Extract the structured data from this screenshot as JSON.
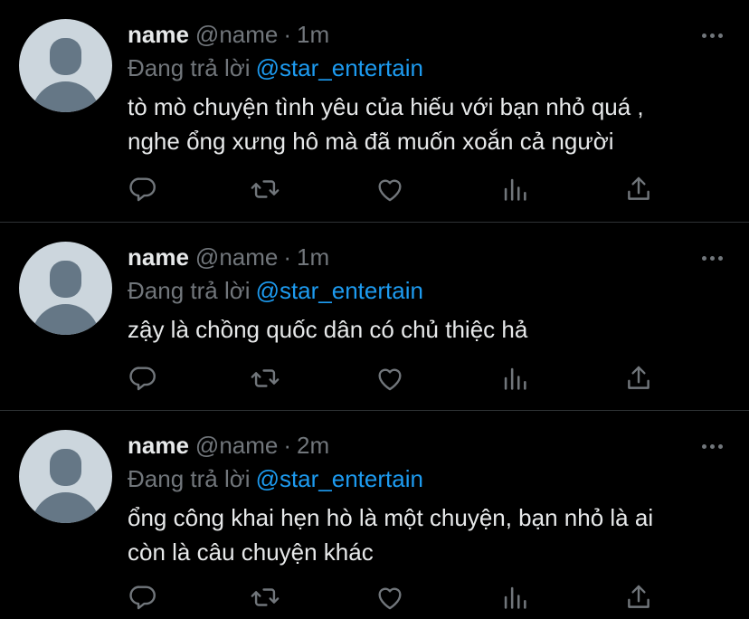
{
  "tweets": [
    {
      "name": "name",
      "handle": "@name",
      "separator": "·",
      "time": "1m",
      "reply_prefix": "Đang trả lời",
      "reply_to": "@star_entertain",
      "text": "tò mò chuyện tình yêu của hiếu với bạn nhỏ quá ,\nnghe ổng xưng hô mà đã muốn xoắn cả người"
    },
    {
      "name": "name",
      "handle": "@name",
      "separator": "·",
      "time": "1m",
      "reply_prefix": "Đang trả lời",
      "reply_to": "@star_entertain",
      "text": "zậy là chồng quốc dân có chủ thiệc hả"
    },
    {
      "name": "name",
      "handle": "@name",
      "separator": "·",
      "time": "2m",
      "reply_prefix": "Đang trả lời",
      "reply_to": "@star_entertain",
      "text": "ổng công khai hẹn hò là một chuyện, bạn nhỏ là ai\ncòn là câu chuyện khác"
    }
  ],
  "icons": {
    "reply": "reply-bubble-icon",
    "retweet": "retweet-icon",
    "like": "heart-icon",
    "stats": "analytics-bars-icon",
    "share": "share-upload-icon",
    "more": "more-dots-icon"
  },
  "colors": {
    "background": "#000000",
    "text": "#e7e9ea",
    "muted": "#71767b",
    "mention": "#1d9bf0",
    "divider": "#2f3336",
    "avatar_bg": "#ccd6dd",
    "avatar_fg": "#657786"
  }
}
